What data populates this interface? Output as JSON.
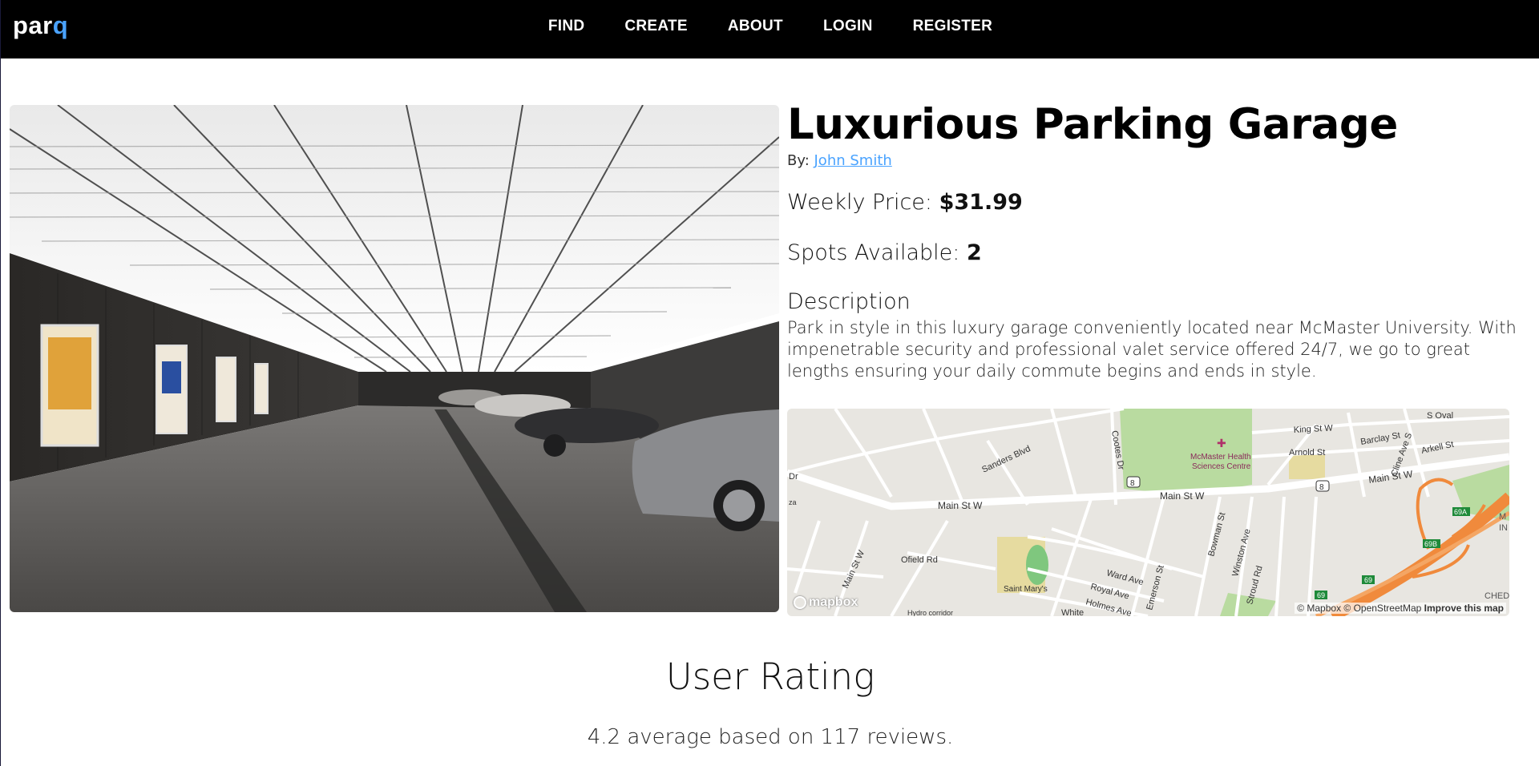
{
  "nav": {
    "brand_main": "par",
    "brand_accent": "q",
    "links": [
      "FIND",
      "CREATE",
      "ABOUT",
      "LOGIN",
      "REGISTER"
    ]
  },
  "listing": {
    "title": "Luxurious Parking Garage",
    "by_label": "By:",
    "owner": "John Smith",
    "price_label": "Weekly Price:",
    "price": "$31.99",
    "spots_label": "Spots Available:",
    "spots": "2",
    "description_heading": "Description",
    "description": "Park in style in this luxury garage conveniently located near McMaster University. With impenetrable security and professional valet service offered 24/7, we go to great lengths ensuring your daily commute begins and ends in style."
  },
  "map": {
    "labels": {
      "main_st_w": "Main St W",
      "sanders": "Sanders Blvd",
      "cootes": "Cootes Dr",
      "mcmaster": "McMaster Health",
      "mcmaster2": "Sciences Centre",
      "king": "King St W",
      "arnold": "Arnold St",
      "barclay": "Barclay St",
      "arkell": "Arkell St",
      "cline": "Cline Ave S",
      "oval": "S Oval",
      "ofield": "Ofield Rd",
      "ward": "Ward Ave",
      "royal": "Royal Ave",
      "holmes": "Holmes Ave",
      "emerson": "Emerson St",
      "bowman": "Bowman St",
      "winston": "Winston Ave",
      "stroud": "Stroud Rd",
      "saint_marys": "Saint Mary's",
      "route8": "8",
      "ramp69": "69",
      "ramp69a": "69A",
      "ramp69b": "69B",
      "dr": "Dr",
      "za": "za",
      "hydro": "Hydro corridor",
      "white": "White",
      "chedo": "CHEDO",
      "m": "M",
      "in": "IN"
    },
    "logo": "mapbox",
    "attribution": "© Mapbox © OpenStreetMap",
    "improve": "Improve this map"
  },
  "rating": {
    "heading": "User Rating",
    "summary": "4.2 average based on 117 reviews."
  }
}
